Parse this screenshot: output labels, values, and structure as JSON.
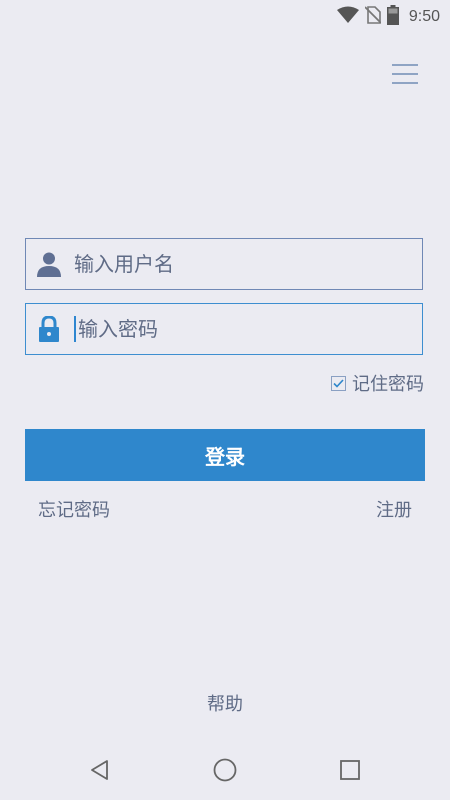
{
  "status_bar": {
    "time": "9:50",
    "icons": [
      "wifi-icon",
      "no-sim-icon",
      "battery-icon"
    ]
  },
  "menu": {
    "icon": "hamburger-menu-icon"
  },
  "login_form": {
    "username": {
      "placeholder": "输入用户名",
      "value": "",
      "icon": "user-icon"
    },
    "password": {
      "placeholder": "输入密码",
      "value": "",
      "icon": "lock-icon"
    },
    "remember_password": {
      "label": "记住密码",
      "checked": true
    },
    "login_button": "登录",
    "forgot_password": "忘记密码",
    "register": "注册"
  },
  "help": "帮助",
  "nav_bar": {
    "icons": [
      "back-icon",
      "home-icon",
      "recent-apps-icon"
    ]
  },
  "colors": {
    "background": "#ebebf2",
    "accent": "#2f87cc",
    "text": "#5f6b86",
    "border": "#6f88b5"
  }
}
